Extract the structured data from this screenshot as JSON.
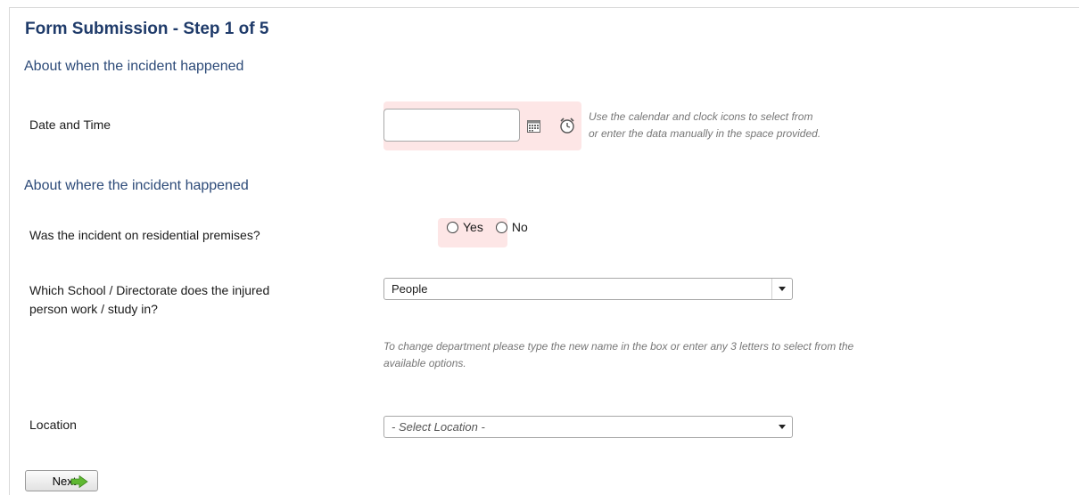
{
  "form": {
    "title": "Form Submission - Step 1 of 5",
    "section_when": "About when the incident happened",
    "section_where": "About where the incident happened",
    "date_time": {
      "label": "Date and Time",
      "value": "",
      "hint_line1": "Use the calendar and clock icons to select from",
      "hint_line2": "or enter the data manually in the space provided."
    },
    "residential": {
      "label": "Was the incident on residential premises?",
      "options": [
        "Yes",
        "No"
      ],
      "selected": null
    },
    "school": {
      "label_line1": "Which School / Directorate does the injured",
      "label_line2": "person work / study in?",
      "value": "People",
      "hint_line1": "To change department please type the new name in the box or enter any 3 letters to select from the",
      "hint_line2": "available options."
    },
    "location": {
      "label": "Location",
      "placeholder": "- Select Location -"
    },
    "next_label": "Next"
  },
  "colors": {
    "title": "#1f3b6a",
    "section": "#2c4a78",
    "highlight": "#fde6e6",
    "next_arrow": "#5fb832"
  }
}
